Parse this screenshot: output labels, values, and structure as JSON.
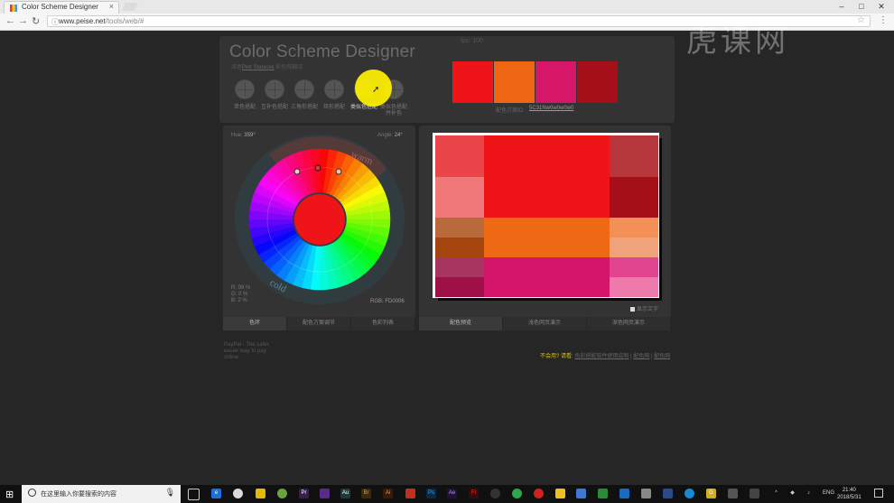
{
  "browser": {
    "tab_title": "Color Scheme Designer",
    "url_host": "www.peise.net",
    "url_path": "/tools/web/#",
    "min_btn": "–",
    "max_btn": "□",
    "close_btn": "✕"
  },
  "app": {
    "title": "Color Scheme Designer",
    "subtitle_prefix": "译者",
    "subtitle_author": "Petr Stanicek",
    "subtitle_link": "配色网翻译",
    "fps": "fps: 100",
    "schemes": [
      {
        "label": "单色搭配"
      },
      {
        "label": "互补色搭配"
      },
      {
        "label": "三角形搭配"
      },
      {
        "label": "矩形搭配"
      },
      {
        "label": "类似色搭配"
      },
      {
        "label": "类似色搭配并补色"
      }
    ],
    "scheme_id_label": "配色方案ID:",
    "scheme_id": "5C31Nw0w0w0w0",
    "swatch_colors": [
      "#ee1417",
      "#ee6611",
      "#d71668",
      "#a50f18"
    ]
  },
  "wheel": {
    "hue_label": "Hue:",
    "hue_value": "359°",
    "angle_label": "Angle:",
    "angle_value": "24°",
    "warm_label": "warm",
    "cold_label": "cold",
    "r_line": "R: 99 %",
    "g_line": "G:  0 %",
    "b_line": "B:  2 %",
    "rgb_label": "RGB:",
    "rgb_hex": "FD0006",
    "center_color": "#ee1417"
  },
  "left_tabs": [
    "色环",
    "配色方案调节",
    "色彩列表"
  ],
  "right_tabs": [
    "配色预览",
    "浅色网页演示",
    "深色网页演示"
  ],
  "preview": {
    "show_text": "显示文字",
    "colors": {
      "primary": "#ee1417",
      "p_light1": "#ea4649",
      "p_light2": "#f07777",
      "p_dark1": "#b6373b",
      "p_dark2": "#a50f18",
      "orange": "#ef6914",
      "o_light1": "#b86a3d",
      "o_dark1": "#a5460f",
      "o_light2": "#f39058",
      "o_light3": "#f0a37a",
      "magenta": "#d31669",
      "m_dark1": "#a8355f",
      "m_dark2": "#a01048",
      "m_light1": "#e2458f",
      "m_light2": "#ee7aac"
    }
  },
  "footer": {
    "left_text": "PayPal - The safer, easier way to pay online.",
    "question": "不会用?",
    "prompt": "请看:",
    "link1": "色彩搭配软件使用说明",
    "sep": "|",
    "link2": "配色网",
    "link3": "配色网"
  },
  "watermark": "虎课网",
  "taskbar": {
    "search_placeholder": "在这里输入你要搜索的内容",
    "lang": "ENG",
    "time": "21:40",
    "date": "2018/5/31"
  }
}
